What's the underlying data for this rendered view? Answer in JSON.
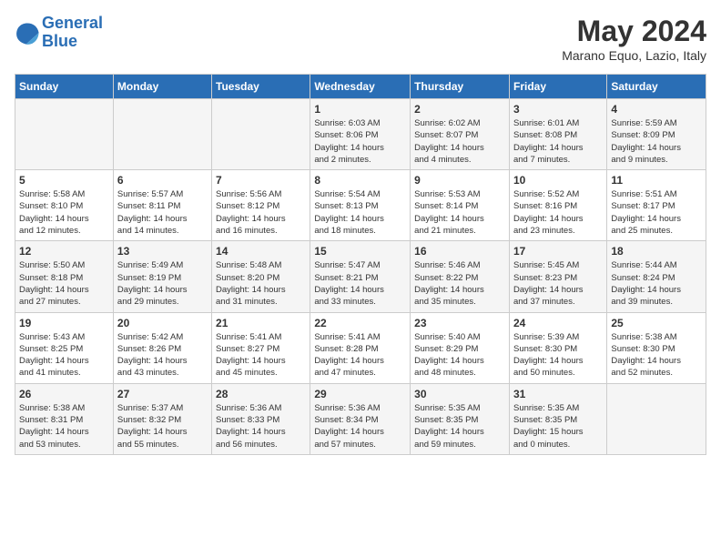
{
  "logo": {
    "line1": "General",
    "line2": "Blue"
  },
  "title": "May 2024",
  "location": "Marano Equo, Lazio, Italy",
  "days_of_week": [
    "Sunday",
    "Monday",
    "Tuesday",
    "Wednesday",
    "Thursday",
    "Friday",
    "Saturday"
  ],
  "weeks": [
    [
      {
        "day": "",
        "text": ""
      },
      {
        "day": "",
        "text": ""
      },
      {
        "day": "",
        "text": ""
      },
      {
        "day": "1",
        "text": "Sunrise: 6:03 AM\nSunset: 8:06 PM\nDaylight: 14 hours\nand 2 minutes."
      },
      {
        "day": "2",
        "text": "Sunrise: 6:02 AM\nSunset: 8:07 PM\nDaylight: 14 hours\nand 4 minutes."
      },
      {
        "day": "3",
        "text": "Sunrise: 6:01 AM\nSunset: 8:08 PM\nDaylight: 14 hours\nand 7 minutes."
      },
      {
        "day": "4",
        "text": "Sunrise: 5:59 AM\nSunset: 8:09 PM\nDaylight: 14 hours\nand 9 minutes."
      }
    ],
    [
      {
        "day": "5",
        "text": "Sunrise: 5:58 AM\nSunset: 8:10 PM\nDaylight: 14 hours\nand 12 minutes."
      },
      {
        "day": "6",
        "text": "Sunrise: 5:57 AM\nSunset: 8:11 PM\nDaylight: 14 hours\nand 14 minutes."
      },
      {
        "day": "7",
        "text": "Sunrise: 5:56 AM\nSunset: 8:12 PM\nDaylight: 14 hours\nand 16 minutes."
      },
      {
        "day": "8",
        "text": "Sunrise: 5:54 AM\nSunset: 8:13 PM\nDaylight: 14 hours\nand 18 minutes."
      },
      {
        "day": "9",
        "text": "Sunrise: 5:53 AM\nSunset: 8:14 PM\nDaylight: 14 hours\nand 21 minutes."
      },
      {
        "day": "10",
        "text": "Sunrise: 5:52 AM\nSunset: 8:16 PM\nDaylight: 14 hours\nand 23 minutes."
      },
      {
        "day": "11",
        "text": "Sunrise: 5:51 AM\nSunset: 8:17 PM\nDaylight: 14 hours\nand 25 minutes."
      }
    ],
    [
      {
        "day": "12",
        "text": "Sunrise: 5:50 AM\nSunset: 8:18 PM\nDaylight: 14 hours\nand 27 minutes."
      },
      {
        "day": "13",
        "text": "Sunrise: 5:49 AM\nSunset: 8:19 PM\nDaylight: 14 hours\nand 29 minutes."
      },
      {
        "day": "14",
        "text": "Sunrise: 5:48 AM\nSunset: 8:20 PM\nDaylight: 14 hours\nand 31 minutes."
      },
      {
        "day": "15",
        "text": "Sunrise: 5:47 AM\nSunset: 8:21 PM\nDaylight: 14 hours\nand 33 minutes."
      },
      {
        "day": "16",
        "text": "Sunrise: 5:46 AM\nSunset: 8:22 PM\nDaylight: 14 hours\nand 35 minutes."
      },
      {
        "day": "17",
        "text": "Sunrise: 5:45 AM\nSunset: 8:23 PM\nDaylight: 14 hours\nand 37 minutes."
      },
      {
        "day": "18",
        "text": "Sunrise: 5:44 AM\nSunset: 8:24 PM\nDaylight: 14 hours\nand 39 minutes."
      }
    ],
    [
      {
        "day": "19",
        "text": "Sunrise: 5:43 AM\nSunset: 8:25 PM\nDaylight: 14 hours\nand 41 minutes."
      },
      {
        "day": "20",
        "text": "Sunrise: 5:42 AM\nSunset: 8:26 PM\nDaylight: 14 hours\nand 43 minutes."
      },
      {
        "day": "21",
        "text": "Sunrise: 5:41 AM\nSunset: 8:27 PM\nDaylight: 14 hours\nand 45 minutes."
      },
      {
        "day": "22",
        "text": "Sunrise: 5:41 AM\nSunset: 8:28 PM\nDaylight: 14 hours\nand 47 minutes."
      },
      {
        "day": "23",
        "text": "Sunrise: 5:40 AM\nSunset: 8:29 PM\nDaylight: 14 hours\nand 48 minutes."
      },
      {
        "day": "24",
        "text": "Sunrise: 5:39 AM\nSunset: 8:30 PM\nDaylight: 14 hours\nand 50 minutes."
      },
      {
        "day": "25",
        "text": "Sunrise: 5:38 AM\nSunset: 8:30 PM\nDaylight: 14 hours\nand 52 minutes."
      }
    ],
    [
      {
        "day": "26",
        "text": "Sunrise: 5:38 AM\nSunset: 8:31 PM\nDaylight: 14 hours\nand 53 minutes."
      },
      {
        "day": "27",
        "text": "Sunrise: 5:37 AM\nSunset: 8:32 PM\nDaylight: 14 hours\nand 55 minutes."
      },
      {
        "day": "28",
        "text": "Sunrise: 5:36 AM\nSunset: 8:33 PM\nDaylight: 14 hours\nand 56 minutes."
      },
      {
        "day": "29",
        "text": "Sunrise: 5:36 AM\nSunset: 8:34 PM\nDaylight: 14 hours\nand 57 minutes."
      },
      {
        "day": "30",
        "text": "Sunrise: 5:35 AM\nSunset: 8:35 PM\nDaylight: 14 hours\nand 59 minutes."
      },
      {
        "day": "31",
        "text": "Sunrise: 5:35 AM\nSunset: 8:35 PM\nDaylight: 15 hours\nand 0 minutes."
      },
      {
        "day": "",
        "text": ""
      }
    ]
  ]
}
